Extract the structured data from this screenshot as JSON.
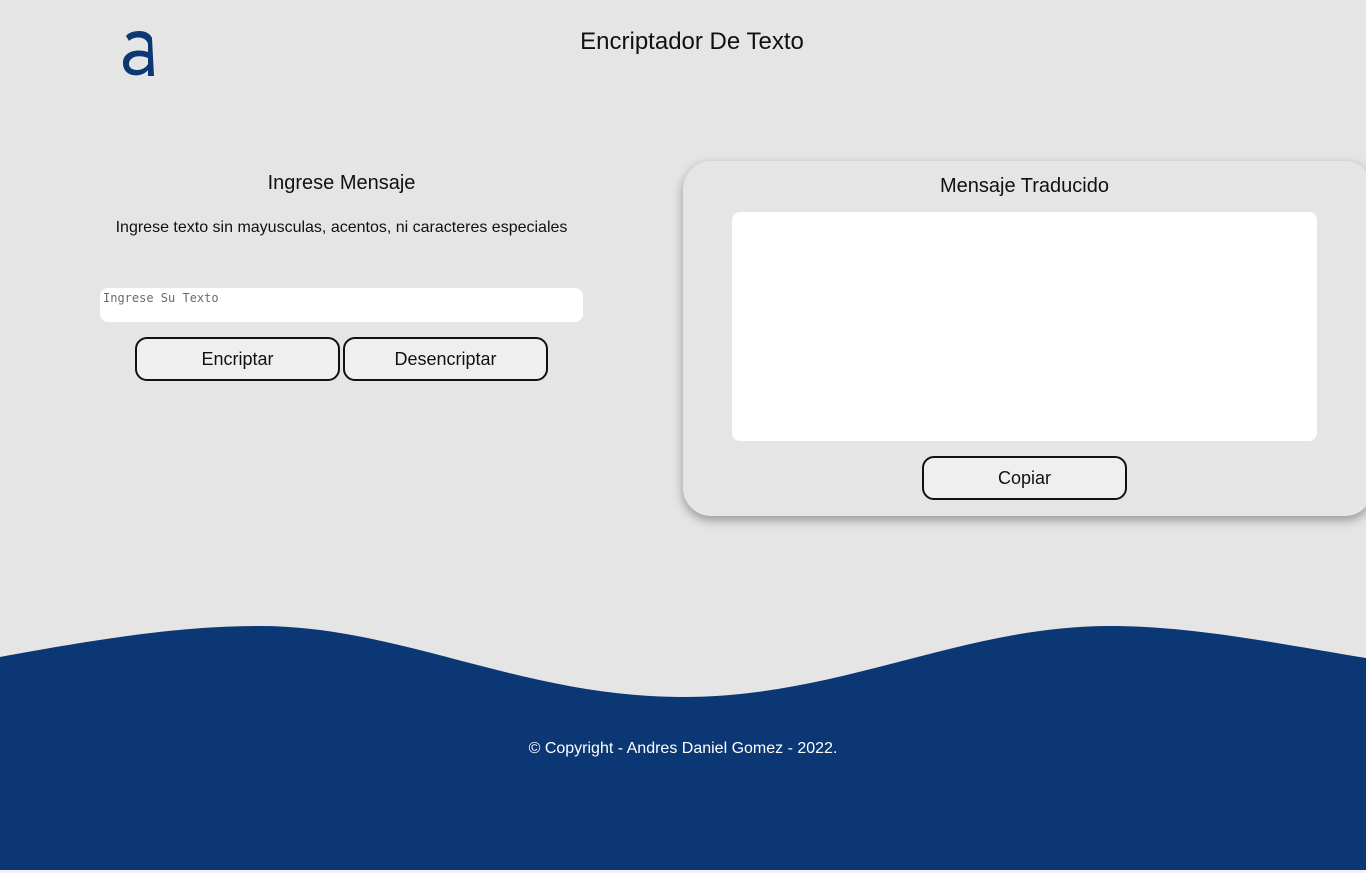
{
  "header": {
    "title": "Encriptador De Texto",
    "logo_icon": "alura-a-logo-icon"
  },
  "input_panel": {
    "title": "Ingrese Mensaje",
    "instructions": "Ingrese texto sin mayusculas, acentos, ni caracteres especiales",
    "input_placeholder": "Ingrese Su Texto",
    "input_value": "",
    "encrypt_label": "Encriptar",
    "decrypt_label": "Desencriptar"
  },
  "output_panel": {
    "title": "Mensaje Traducido",
    "output_value": "",
    "copy_label": "Copiar"
  },
  "footer": {
    "text": "© Copyright - Andres Daniel Gomez - 2022."
  },
  "colors": {
    "background": "#e5e5e5",
    "brand_blue": "#0c3775",
    "button_bg": "#efefef",
    "panel_white": "#ffffff"
  }
}
